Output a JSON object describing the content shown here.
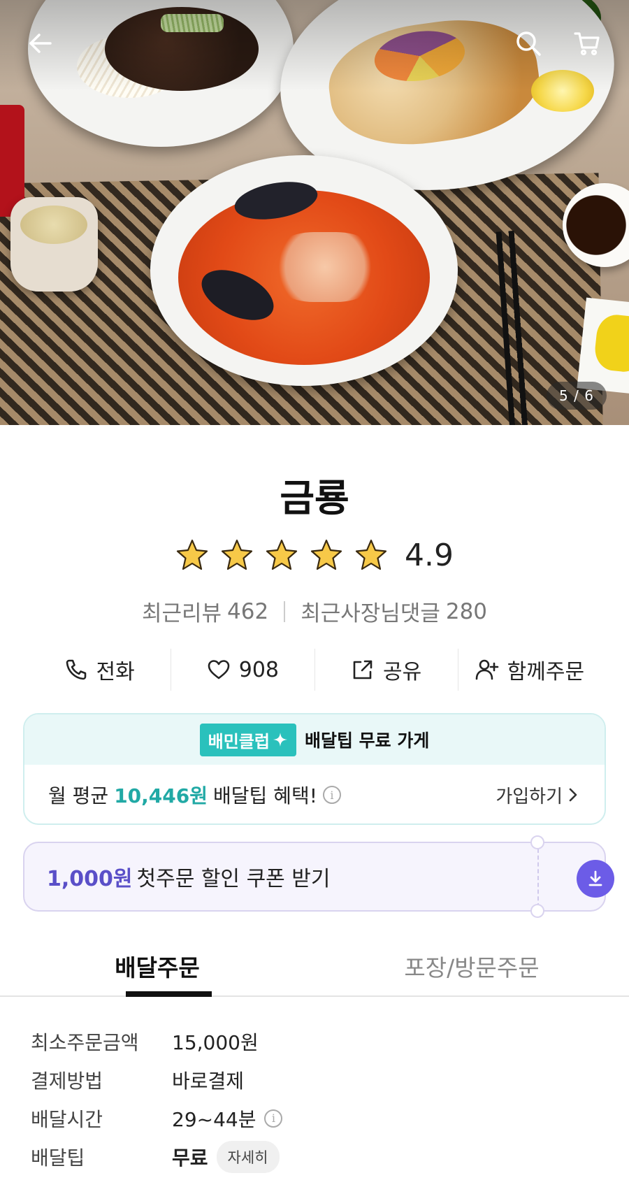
{
  "hero": {
    "pager": "5 / 6"
  },
  "store": {
    "name": "금룡",
    "rating": "4.9",
    "recent_reviews_label": "최근리뷰",
    "recent_reviews_count": "462",
    "owner_replies_label": "최근사장님댓글",
    "owner_replies_count": "280"
  },
  "actions": {
    "call": "전화",
    "like_count": "908",
    "share": "공유",
    "group_order": "함께주문"
  },
  "club": {
    "badge": "배민클럽",
    "title": "배달팁 무료 가게",
    "benefit_prefix": "월 평균",
    "benefit_amount": "10,446원",
    "benefit_suffix": "배달팁 혜택!",
    "join": "가입하기"
  },
  "coupon": {
    "amount": "1,000원",
    "text": "첫주문 할인 쿠폰 받기"
  },
  "tabs": [
    {
      "label": "배달주문"
    },
    {
      "label": "포장/방문주문"
    }
  ],
  "order_info": [
    {
      "key": "최소주문금액",
      "value": "15,000원"
    },
    {
      "key": "결제방법",
      "value": "바로결제"
    },
    {
      "key": "배달시간",
      "value": "29~44분"
    },
    {
      "key": "배달팁",
      "value": "무료",
      "chip": "자세히"
    }
  ],
  "colors": {
    "club_accent": "#2ac1bc",
    "coupon_accent": "#6c5ce7",
    "star": "#f7c948"
  }
}
